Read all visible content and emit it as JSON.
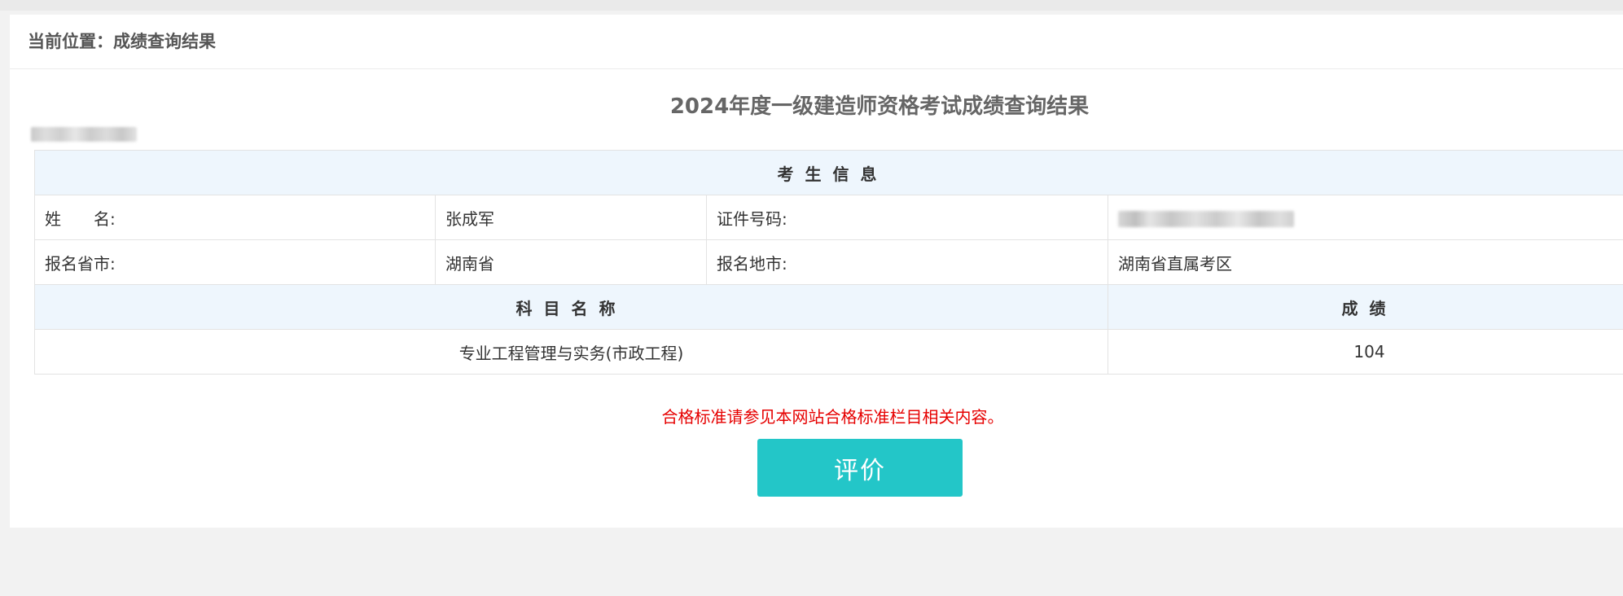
{
  "breadcrumb": "当前位置：成绩查询结果",
  "title": "2024年度一级建造师资格考试成绩查询结果",
  "info_header": "考生信息",
  "labels": {
    "name": "姓　　名:",
    "cert": "证件号码:",
    "province": "报名省市:",
    "city": "报名地市:"
  },
  "values": {
    "name": "张成军",
    "province": "湖南省",
    "city": "湖南省直属考区"
  },
  "scores": {
    "subject_header": "科目名称",
    "score_header": "成绩",
    "rows": [
      {
        "subject": "专业工程管理与实务(市政工程)",
        "score": "104"
      }
    ]
  },
  "note": "合格标准请参见本网站合格标准栏目相关内容。",
  "button": "评价",
  "colors": {
    "accent": "#23c6c8",
    "note": "#e60000",
    "header_bg": "#eef6fd"
  }
}
